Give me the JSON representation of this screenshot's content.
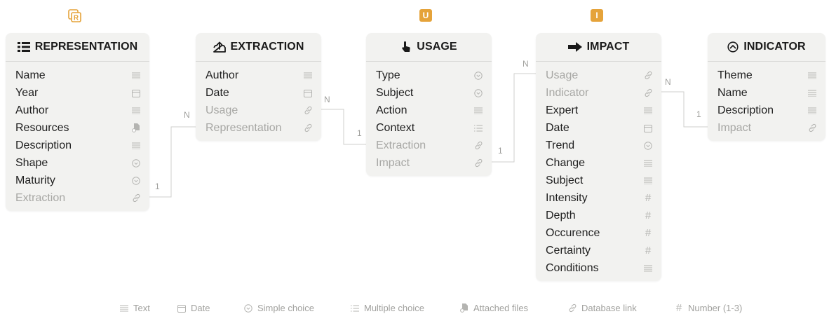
{
  "tables": [
    {
      "id": "representation",
      "title": "REPRESENTATION",
      "icon": "grid-icon",
      "fields": [
        {
          "label": "Name",
          "type": "text"
        },
        {
          "label": "Year",
          "type": "date"
        },
        {
          "label": "Author",
          "type": "text"
        },
        {
          "label": "Resources",
          "type": "files"
        },
        {
          "label": "Description",
          "type": "text"
        },
        {
          "label": "Shape",
          "type": "choice"
        },
        {
          "label": "Maturity",
          "type": "choice"
        },
        {
          "label": "Extraction",
          "type": "link"
        }
      ]
    },
    {
      "id": "extraction",
      "title": "EXTRACTION",
      "icon": "upload-box-icon",
      "fields": [
        {
          "label": "Author",
          "type": "text"
        },
        {
          "label": "Date",
          "type": "date"
        },
        {
          "label": "Usage",
          "type": "link"
        },
        {
          "label": "Representation",
          "type": "link"
        }
      ]
    },
    {
      "id": "usage",
      "title": "USAGE",
      "icon": "pointer-hand-icon",
      "badge": "U",
      "fields": [
        {
          "label": "Type",
          "type": "choice"
        },
        {
          "label": "Subject",
          "type": "choice"
        },
        {
          "label": "Action",
          "type": "text"
        },
        {
          "label": "Context",
          "type": "multi"
        },
        {
          "label": "Extraction",
          "type": "link"
        },
        {
          "label": "Impact",
          "type": "link"
        }
      ]
    },
    {
      "id": "impact",
      "title": "IMPACT",
      "icon": "arrow-right-icon",
      "badge": "I",
      "fields": [
        {
          "label": "Usage",
          "type": "link"
        },
        {
          "label": "Indicator",
          "type": "link"
        },
        {
          "label": "Expert",
          "type": "text"
        },
        {
          "label": "Date",
          "type": "date"
        },
        {
          "label": "Trend",
          "type": "choice"
        },
        {
          "label": "Change",
          "type": "text"
        },
        {
          "label": "Subject",
          "type": "text"
        },
        {
          "label": "Intensity",
          "type": "number"
        },
        {
          "label": "Depth",
          "type": "number"
        },
        {
          "label": "Occurence",
          "type": "number"
        },
        {
          "label": "Certainty",
          "type": "number"
        },
        {
          "label": "Conditions",
          "type": "text"
        }
      ]
    },
    {
      "id": "indicator",
      "title": "INDICATOR",
      "icon": "gauge-icon",
      "fields": [
        {
          "label": "Theme",
          "type": "text"
        },
        {
          "label": "Name",
          "type": "text"
        },
        {
          "label": "Description",
          "type": "text"
        },
        {
          "label": "Impact",
          "type": "link"
        }
      ]
    }
  ],
  "representation_badge": "R",
  "cardinalities": {
    "rep_ext_one": "1",
    "rep_ext_many": "N",
    "ext_usage_many": "N",
    "ext_usage_one": "1",
    "usage_impact_one": "1",
    "usage_impact_many": "N",
    "impact_ind_many": "N",
    "impact_ind_one": "1"
  },
  "legend": [
    {
      "type": "text",
      "label": "Text"
    },
    {
      "type": "date",
      "label": "Date"
    },
    {
      "type": "choice",
      "label": "Simple choice"
    },
    {
      "type": "multi",
      "label": "Multiple choice"
    },
    {
      "type": "files",
      "label": "Attached files"
    },
    {
      "type": "link",
      "label": "Database link"
    },
    {
      "type": "number",
      "label": "Number (1-3)"
    }
  ],
  "colors": {
    "badge": "#e5a33a",
    "table_bg": "#f2f2f0",
    "connector": "#cfcfcc",
    "muted_text": "#a7a7a4"
  }
}
